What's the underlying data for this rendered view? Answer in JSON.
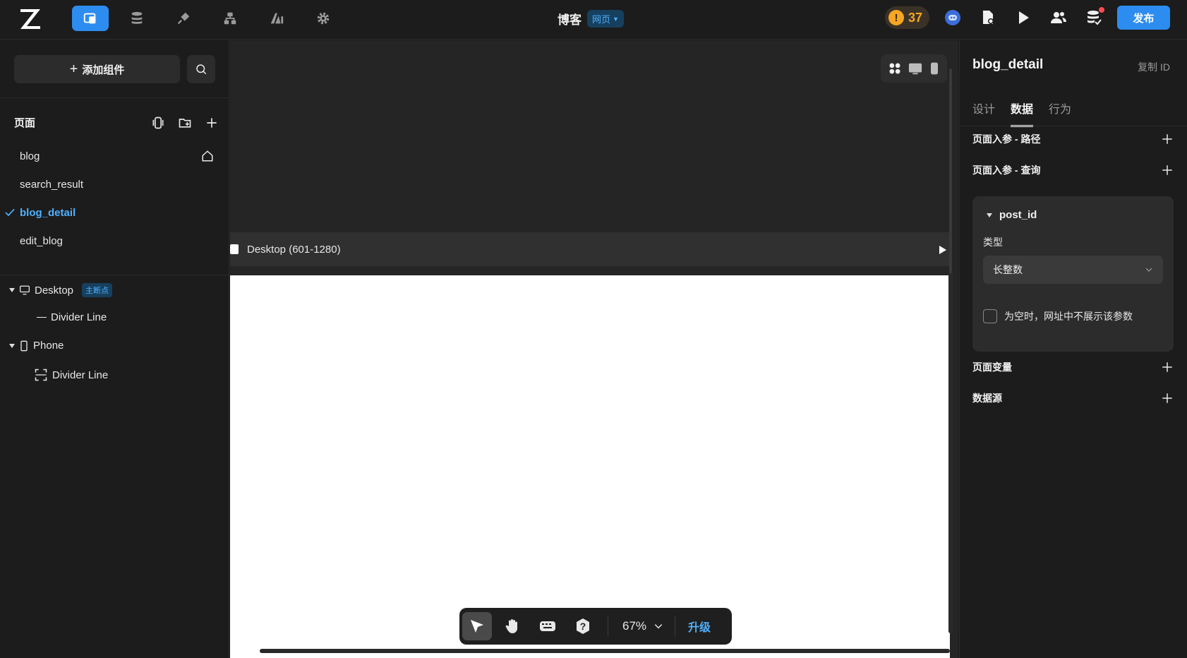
{
  "topbar": {
    "title": "博客",
    "type_label": "网页",
    "warning_count": "37",
    "warning_symbol": "!",
    "publish_label": "发布",
    "accent": "#2d8cf0"
  },
  "left": {
    "add_component_label": "添加组件",
    "pages_title": "页面",
    "pages": [
      {
        "label": "blog"
      },
      {
        "label": "search_result"
      },
      {
        "label": "blog_detail"
      },
      {
        "label": "edit_blog"
      }
    ],
    "tree": {
      "desktop_label": "Desktop",
      "desktop_badge": "主断点",
      "desktop_child": "Divider Line",
      "phone_label": "Phone",
      "phone_child": "Divider Line"
    }
  },
  "canvas": {
    "breakpoint_label": "Desktop (601-1280)",
    "zoom": "67%",
    "upgrade_label": "升级"
  },
  "right": {
    "title": "blog_detail",
    "copy_id_label": "复制 ID",
    "tabs": [
      {
        "label": "设计"
      },
      {
        "label": "数据"
      },
      {
        "label": "行为"
      }
    ],
    "path_params_label": "页面入参 - 路径",
    "query_params_label": "页面入参 - 查询",
    "param": {
      "name": "post_id",
      "type_label": "类型",
      "type_value": "长整数",
      "hide_if_empty_label": "为空时，网址中不展示该参数"
    },
    "page_vars_label": "页面变量",
    "datasource_label": "数据源"
  }
}
